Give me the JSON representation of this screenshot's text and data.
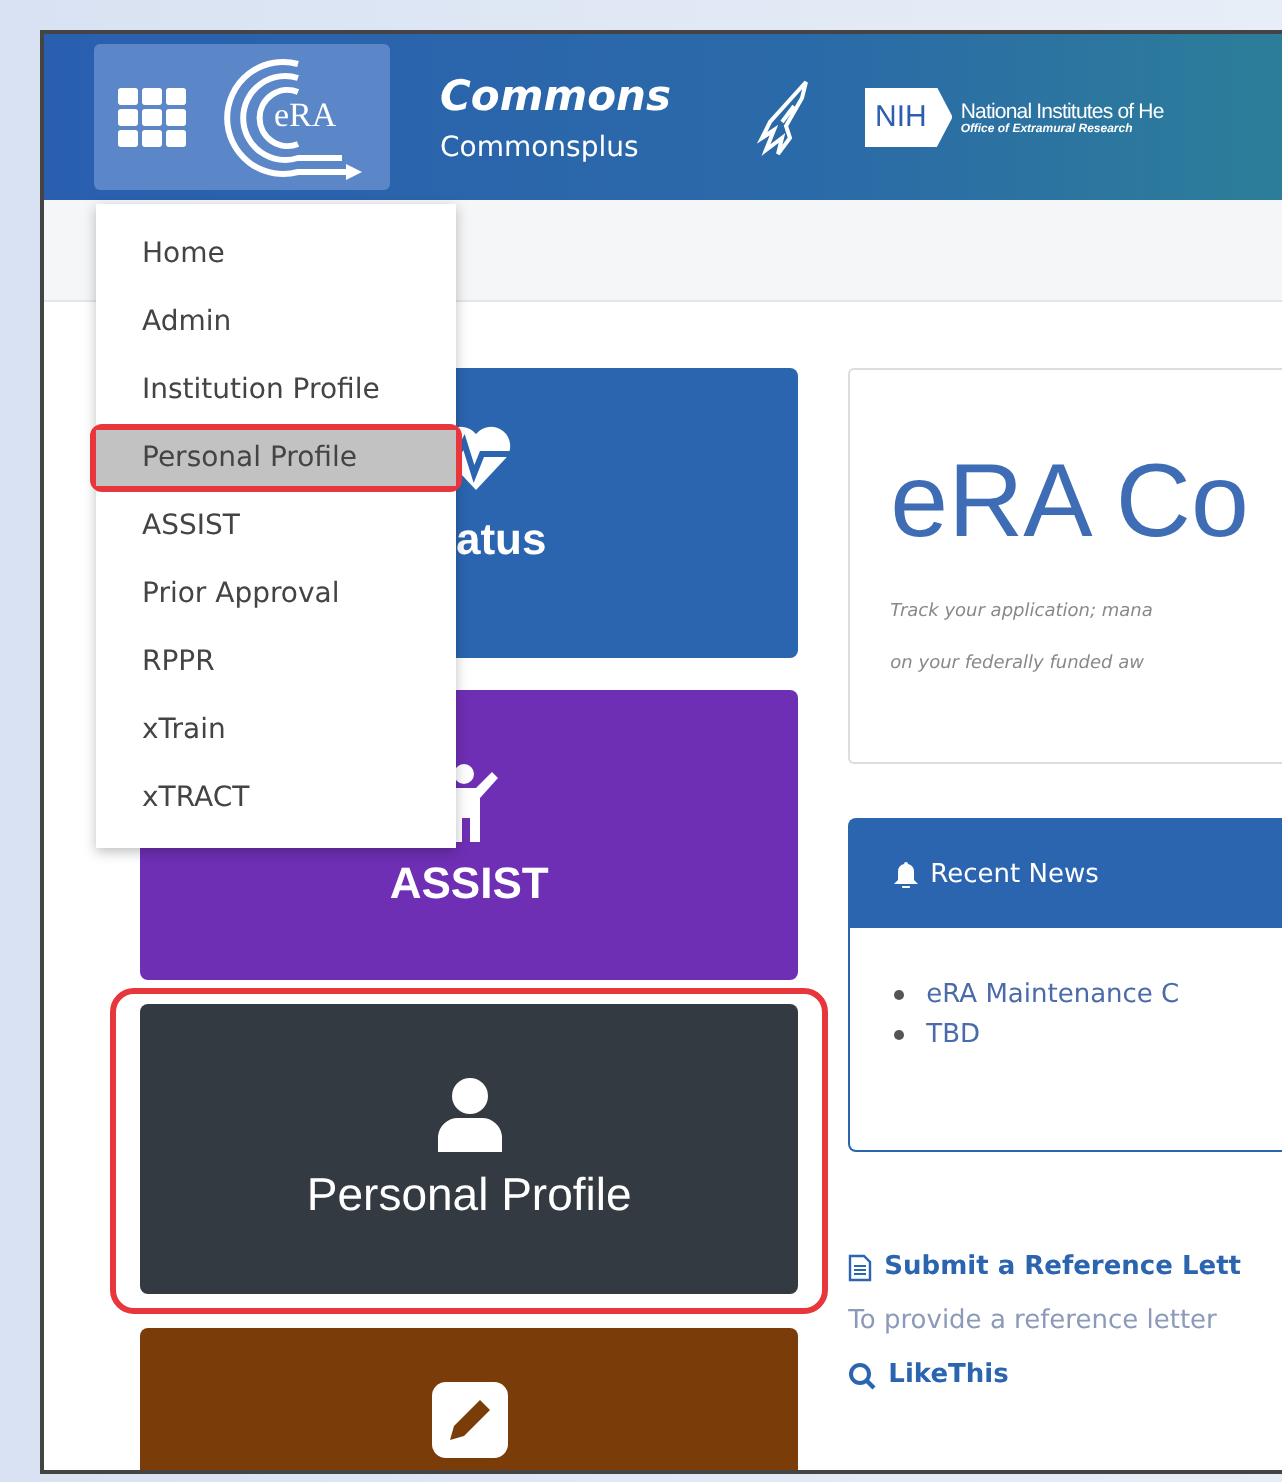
{
  "header": {
    "logo_text": "eRA",
    "title": "Commons",
    "subtitle": "Commonsplus",
    "agency_mark": "NIH",
    "agency_name": "National Institutes of He",
    "agency_office": "Office of Extramural Research"
  },
  "menu": {
    "items": [
      {
        "label": "Home",
        "selected": false,
        "highlighted": false
      },
      {
        "label": "Admin",
        "selected": false,
        "highlighted": false
      },
      {
        "label": "Institution Profile",
        "selected": false,
        "highlighted": false
      },
      {
        "label": "Personal Profile",
        "selected": true,
        "highlighted": true
      },
      {
        "label": "ASSIST",
        "selected": false,
        "highlighted": false
      },
      {
        "label": "Prior Approval",
        "selected": false,
        "highlighted": false
      },
      {
        "label": "RPPR",
        "selected": false,
        "highlighted": false
      },
      {
        "label": "xTrain",
        "selected": false,
        "highlighted": false
      },
      {
        "label": "xTRACT",
        "selected": false,
        "highlighted": false
      }
    ]
  },
  "tiles": [
    {
      "kind": "status",
      "label": "atus",
      "color": "#2b65b0",
      "highlighted": false
    },
    {
      "kind": "assist",
      "label": "ASSIST",
      "color": "#6f2fb5",
      "highlighted": false
    },
    {
      "kind": "profile",
      "label": "Personal Profile",
      "color": "#343a42",
      "highlighted": true
    },
    {
      "kind": "edit",
      "color": "#7a3c08",
      "highlighted": false
    }
  ],
  "welcome": {
    "title": "eRA Co",
    "lines": [
      "Track your application; mana",
      "on your federally funded aw"
    ]
  },
  "news": {
    "title": "Recent News",
    "items": [
      "eRA Maintenance C",
      "TBD"
    ]
  },
  "links": [
    {
      "kind": "document",
      "title": "Submit a Reference Lett",
      "text": "To provide a reference letter"
    },
    {
      "kind": "search",
      "title": "LikeThis"
    }
  ]
}
